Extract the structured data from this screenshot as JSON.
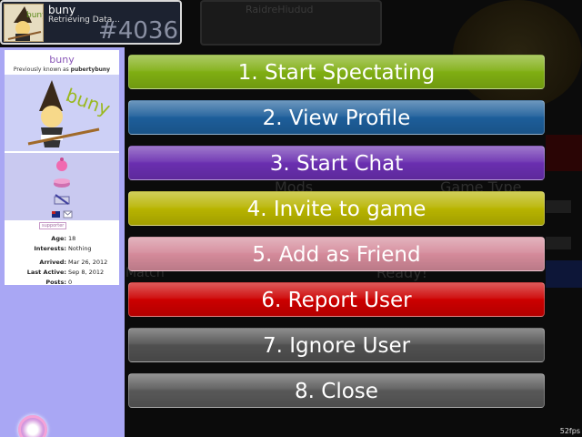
{
  "user": {
    "name": "buny",
    "status": "Retrieving Data...",
    "rank": "#4036",
    "avatar_text": "buny"
  },
  "profile": {
    "name": "buny",
    "previously_prefix": "Previously known as",
    "previously_name": "pubertybuny",
    "art_text": "buny",
    "badge": "supporter",
    "rows": [
      {
        "key": "Age:",
        "value": "18"
      },
      {
        "key": "Interests:",
        "value": "Nothing"
      },
      {
        "key": "Arrived:",
        "value": "Mar 26, 2012"
      },
      {
        "key": "Last Active:",
        "value": "Sep 8, 2012"
      },
      {
        "key": "Posts:",
        "value": "0"
      }
    ]
  },
  "menu": {
    "items": [
      {
        "label": "1. Start Spectating",
        "color": "#7fae12"
      },
      {
        "label": "2. View Profile",
        "color": "#1d5e9a"
      },
      {
        "label": "3. Start Chat",
        "color": "#6a2fb0"
      },
      {
        "label": "4. Invite to game",
        "color": "#b8b400"
      },
      {
        "label": "5. Add as Friend",
        "color": "#d48a9a"
      },
      {
        "label": "6. Report User",
        "color": "#cc0000"
      },
      {
        "label": "7. Ignore User",
        "color": "#505050"
      },
      {
        "label": "8. Close",
        "color": "#585858"
      }
    ]
  },
  "background": {
    "player_name": "RaidreHiudud",
    "mods_label": "Mods",
    "game_type_label": "Game Type",
    "match_label": "Match",
    "ready_label": "Ready!"
  },
  "fps": "52fps"
}
